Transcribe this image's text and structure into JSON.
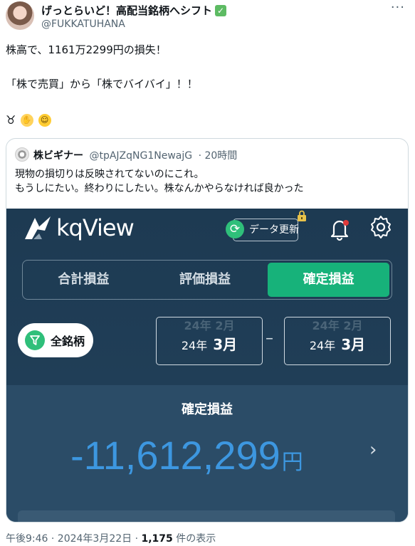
{
  "author": {
    "display_name": "げっとらいど！高配当銘柄へシフト",
    "handle": "@FUKKATUHANA"
  },
  "tweet": {
    "line1": "株高で、1161万2299円の損失！",
    "line2": "「株で売買」から「株でバイバイ」！！",
    "emoji_symbol": "♉"
  },
  "quoted": {
    "display_name": "株ビギナー",
    "handle": "@tpAJZqNG1NewajG",
    "time": "· 20時間",
    "text_line1": "現物の損切りは反映されてないのにこれ。",
    "text_line2": "もうしにたい。終わりにしたい。株なんかやらなければ良かった"
  },
  "app": {
    "logo_text": "kqView",
    "data_update_label": "データ更新",
    "tabs": [
      {
        "label": "合計損益",
        "active": false
      },
      {
        "label": "評価損益",
        "active": false
      },
      {
        "label": "確定損益",
        "active": true
      }
    ],
    "filter_label": "全銘柄",
    "date_start": {
      "ghost": "24年 2月",
      "year": "24年",
      "month": "3月"
    },
    "date_end": {
      "ghost": "24年 2月",
      "year": "24年",
      "month": "3月"
    },
    "date_separator": "–",
    "result_label": "確定損益",
    "result_value": "-11,612,299",
    "result_unit": "円",
    "colors": {
      "accent_green": "#17b27a",
      "value_blue": "#3d97e0",
      "bg_navy": "#1d3a52"
    }
  },
  "footer": {
    "timestamp": "午後9:46 · 2024年3月22日 · ",
    "views_count": "1,175",
    "views_label": " 件の表示"
  }
}
